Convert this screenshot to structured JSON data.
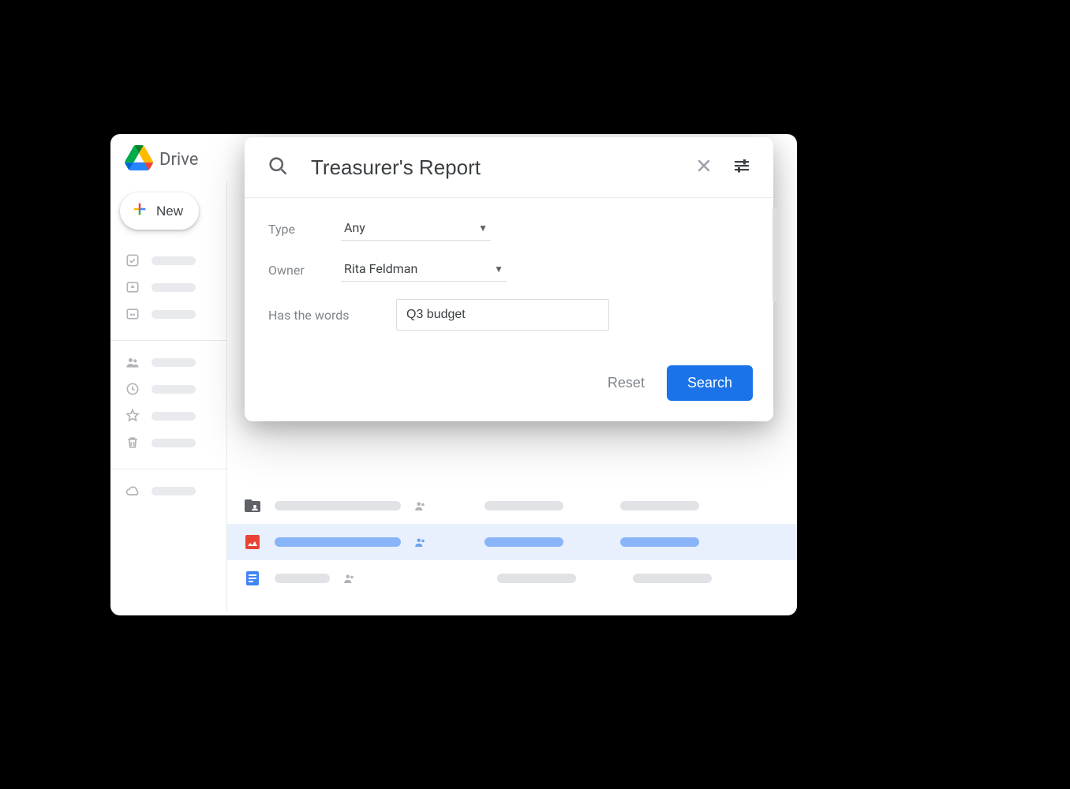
{
  "app": {
    "title": "Drive",
    "new_button": "New"
  },
  "search": {
    "query": "Treasurer's Report",
    "filters": {
      "type_label": "Type",
      "type_value": "Any",
      "owner_label": "Owner",
      "owner_value": "Rita Feldman",
      "words_label": "Has the words",
      "words_value": "Q3 budget"
    },
    "reset_label": "Reset",
    "search_label": "Search"
  }
}
